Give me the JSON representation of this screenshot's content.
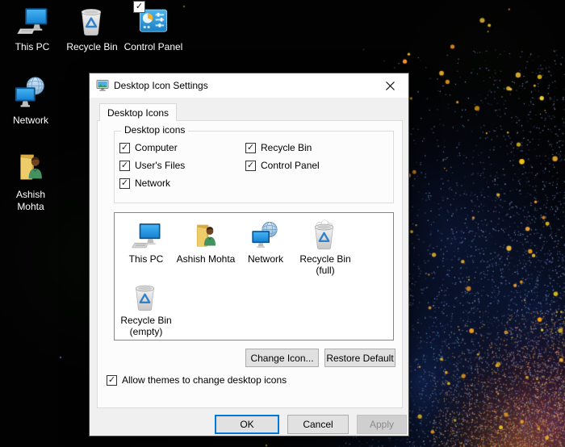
{
  "desktop": {
    "icons": [
      {
        "label": "This PC"
      },
      {
        "label": "Recycle Bin"
      },
      {
        "label": "Control Panel",
        "selected_checkbox": true
      },
      {
        "label": "Network"
      },
      {
        "label": "Ashish Mohta"
      }
    ]
  },
  "dialog": {
    "title": "Desktop Icon Settings",
    "tab_label": "Desktop Icons",
    "group_label": "Desktop icons",
    "checkboxes": [
      {
        "label": "Computer",
        "checked": true
      },
      {
        "label": "User's Files",
        "checked": true
      },
      {
        "label": "Network",
        "checked": true
      },
      {
        "label": "Recycle Bin",
        "checked": true
      },
      {
        "label": "Control Panel",
        "checked": true
      }
    ],
    "preview_items": [
      {
        "label": "This PC"
      },
      {
        "label": "Ashish Mohta"
      },
      {
        "label": "Network"
      },
      {
        "label": "Recycle Bin (full)"
      },
      {
        "label": "Recycle Bin (empty)"
      }
    ],
    "change_icon_label": "Change Icon...",
    "restore_default_label": "Restore Default",
    "allow_themes_label": "Allow themes to change desktop icons",
    "allow_themes_checked": true,
    "ok_label": "OK",
    "cancel_label": "Cancel",
    "apply_label": "Apply",
    "apply_disabled": true
  },
  "glyphs": {
    "check": "✓"
  },
  "colors": {
    "accent_focus": "#0078d7",
    "titlebar_bg": "#ffffff",
    "dialog_bg": "#f0f0f0",
    "page_bg": "#fcfcfc",
    "button_bg": "#e1e1e1",
    "button_border": "#adadad",
    "listview_border": "#828790",
    "desktop_label": "#ffffff"
  }
}
